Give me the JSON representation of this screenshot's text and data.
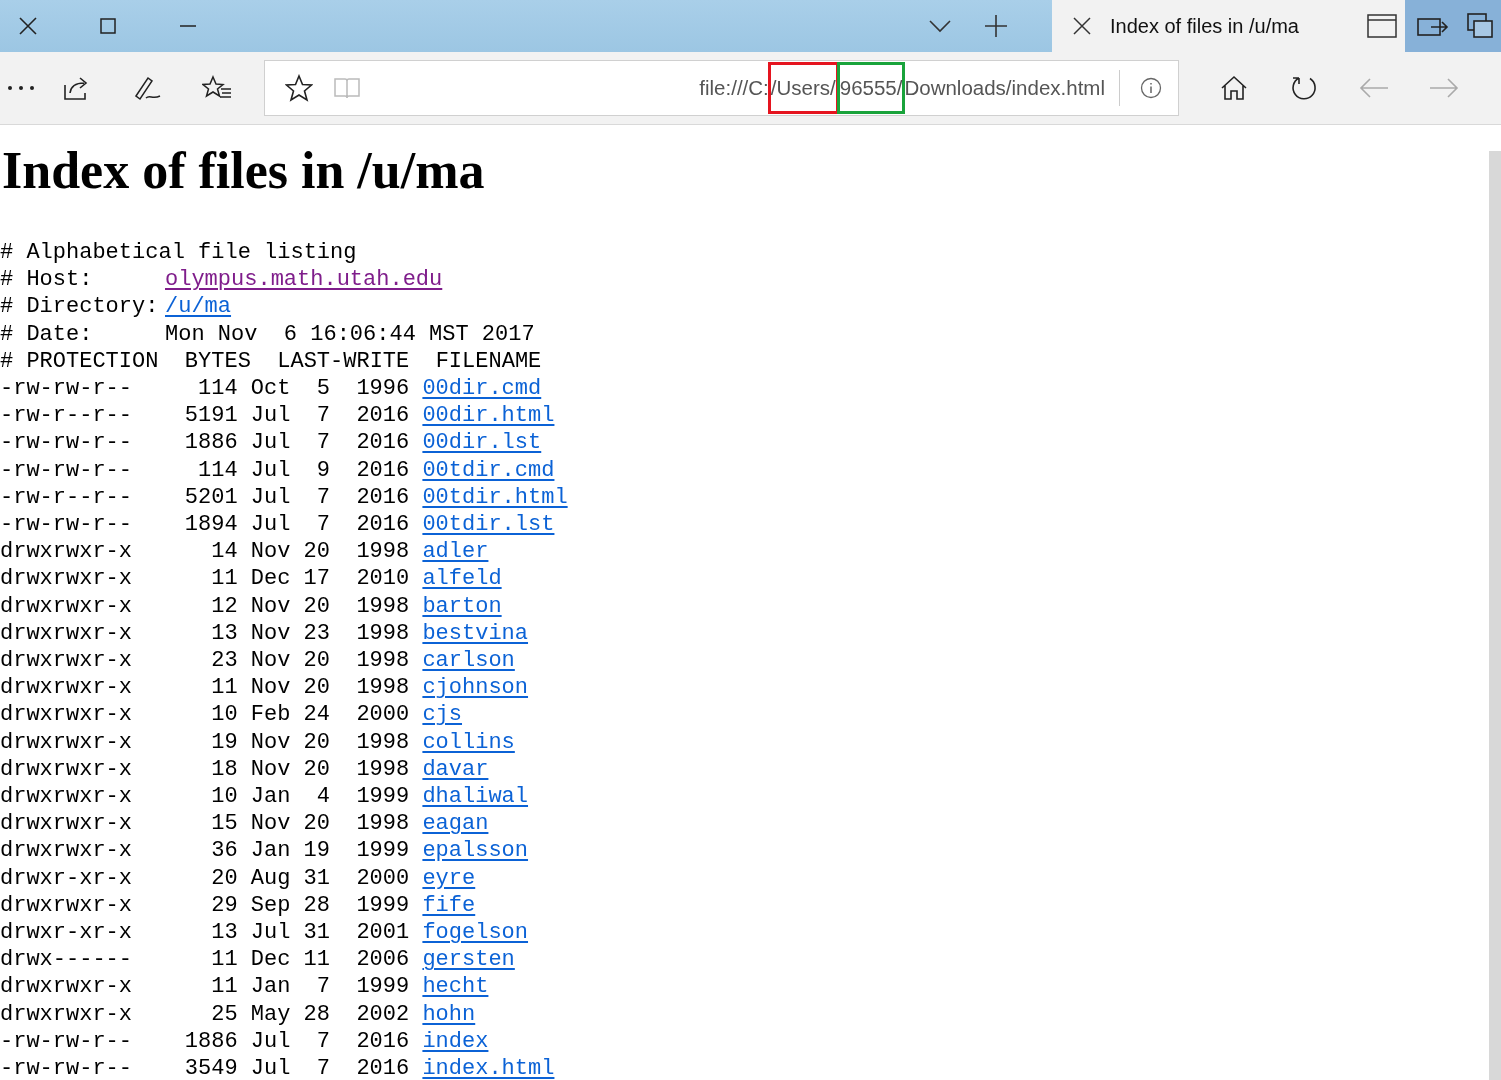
{
  "tab": {
    "title": "Index of files in /u/ma",
    "selected": true
  },
  "address": {
    "parts": [
      {
        "text": "file:///C:"
      },
      {
        "text": "/Users/",
        "color": "#e5141f"
      },
      {
        "text": "96555/",
        "color": "#19a33b"
      },
      {
        "text": "Downloads/index.html"
      }
    ]
  },
  "nav": {
    "back_disabled": true,
    "forward_disabled": true
  },
  "page": {
    "heading": "Index of files in /u/ma",
    "comment": "# Alphabetical file listing",
    "meta": [
      {
        "label": "# Host:",
        "value": "olympus.math.utah.edu",
        "kind": "link",
        "visited": true
      },
      {
        "label": "# Directory:",
        "value": "/u/ma",
        "kind": "link",
        "visited": false
      },
      {
        "label": "# Date:",
        "value": "Mon Nov  6 16:06:44 MST 2017",
        "kind": "text"
      }
    ],
    "columns_line": "# PROTECTION  BYTES  LAST-WRITE  FILENAME",
    "rows": [
      {
        "protection": "-rw-rw-r--",
        "bytes": "114",
        "month": "Oct",
        "day": "5",
        "year": "1996",
        "filename": "00dir.cmd"
      },
      {
        "protection": "-rw-r--r--",
        "bytes": "5191",
        "month": "Jul",
        "day": "7",
        "year": "2016",
        "filename": "00dir.html"
      },
      {
        "protection": "-rw-rw-r--",
        "bytes": "1886",
        "month": "Jul",
        "day": "7",
        "year": "2016",
        "filename": "00dir.lst"
      },
      {
        "protection": "-rw-rw-r--",
        "bytes": "114",
        "month": "Jul",
        "day": "9",
        "year": "2016",
        "filename": "00tdir.cmd"
      },
      {
        "protection": "-rw-r--r--",
        "bytes": "5201",
        "month": "Jul",
        "day": "7",
        "year": "2016",
        "filename": "00tdir.html"
      },
      {
        "protection": "-rw-rw-r--",
        "bytes": "1894",
        "month": "Jul",
        "day": "7",
        "year": "2016",
        "filename": "00tdir.lst"
      },
      {
        "protection": "drwxrwxr-x",
        "bytes": "14",
        "month": "Nov",
        "day": "20",
        "year": "1998",
        "filename": "adler"
      },
      {
        "protection": "drwxrwxr-x",
        "bytes": "11",
        "month": "Dec",
        "day": "17",
        "year": "2010",
        "filename": "alfeld"
      },
      {
        "protection": "drwxrwxr-x",
        "bytes": "12",
        "month": "Nov",
        "day": "20",
        "year": "1998",
        "filename": "barton"
      },
      {
        "protection": "drwxrwxr-x",
        "bytes": "13",
        "month": "Nov",
        "day": "23",
        "year": "1998",
        "filename": "bestvina"
      },
      {
        "protection": "drwxrwxr-x",
        "bytes": "23",
        "month": "Nov",
        "day": "20",
        "year": "1998",
        "filename": "carlson"
      },
      {
        "protection": "drwxrwxr-x",
        "bytes": "11",
        "month": "Nov",
        "day": "20",
        "year": "1998",
        "filename": "cjohnson"
      },
      {
        "protection": "drwxrwxr-x",
        "bytes": "10",
        "month": "Feb",
        "day": "24",
        "year": "2000",
        "filename": "cjs"
      },
      {
        "protection": "drwxrwxr-x",
        "bytes": "19",
        "month": "Nov",
        "day": "20",
        "year": "1998",
        "filename": "collins"
      },
      {
        "protection": "drwxrwxr-x",
        "bytes": "18",
        "month": "Nov",
        "day": "20",
        "year": "1998",
        "filename": "davar"
      },
      {
        "protection": "drwxrwxr-x",
        "bytes": "10",
        "month": "Jan",
        "day": "4",
        "year": "1999",
        "filename": "dhaliwal"
      },
      {
        "protection": "drwxrwxr-x",
        "bytes": "15",
        "month": "Nov",
        "day": "20",
        "year": "1998",
        "filename": "eagan"
      },
      {
        "protection": "drwxrwxr-x",
        "bytes": "36",
        "month": "Jan",
        "day": "19",
        "year": "1999",
        "filename": "epalsson"
      },
      {
        "protection": "drwxr-xr-x",
        "bytes": "20",
        "month": "Aug",
        "day": "31",
        "year": "2000",
        "filename": "eyre"
      },
      {
        "protection": "drwxrwxr-x",
        "bytes": "29",
        "month": "Sep",
        "day": "28",
        "year": "1999",
        "filename": "fife"
      },
      {
        "protection": "drwxr-xr-x",
        "bytes": "13",
        "month": "Jul",
        "day": "31",
        "year": "2001",
        "filename": "fogelson"
      },
      {
        "protection": "drwx------",
        "bytes": "11",
        "month": "Dec",
        "day": "11",
        "year": "2006",
        "filename": "gersten"
      },
      {
        "protection": "drwxrwxr-x",
        "bytes": "11",
        "month": "Jan",
        "day": "7",
        "year": "1999",
        "filename": "hecht"
      },
      {
        "protection": "drwxrwxr-x",
        "bytes": "25",
        "month": "May",
        "day": "28",
        "year": "2002",
        "filename": "hohn"
      },
      {
        "protection": "-rw-rw-r--",
        "bytes": "1886",
        "month": "Jul",
        "day": "7",
        "year": "2016",
        "filename": "index"
      },
      {
        "protection": "-rw-rw-r--",
        "bytes": "3549",
        "month": "Jul",
        "day": "7",
        "year": "2016",
        "filename": "index.html"
      }
    ]
  }
}
